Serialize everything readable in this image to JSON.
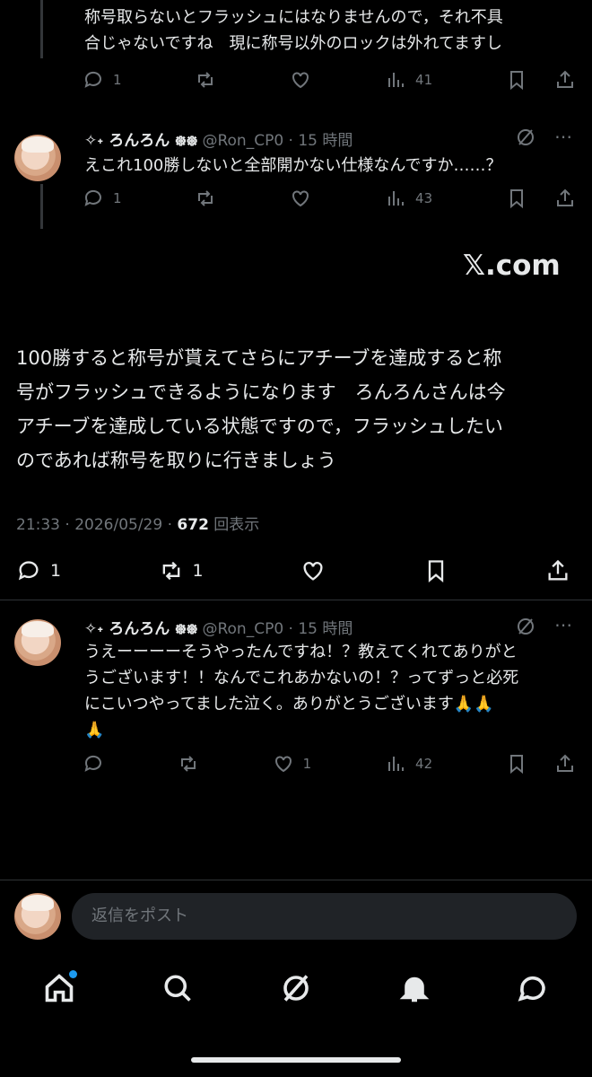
{
  "top_reply": {
    "text": "称号取らないとフラッシュにはなりませんので，それ不具合じゃないですね　現に称号以外のロックは外れてますし",
    "line1": "称号取らないとフラッシュにはなりませんので，それ不具",
    "line2": "合じゃないですね　現に称号以外のロックは外れてますし",
    "reply_count": "1",
    "view_count": "41"
  },
  "reply1": {
    "display_name": "✧˖ ろんろん ᪥᪥",
    "handle": "@Ron_CP0 · 15 時間",
    "text": "えこれ100勝しないと全部開かない仕様なんですか……？",
    "reply_count": "1",
    "view_count": "43"
  },
  "quoted_source": "𝕏.com",
  "main_post": {
    "line1": "100勝すると称号が貰えてさらにアチーブを達成すると称",
    "line2": "号がフラッシュできるようになります　ろんろんさんは今",
    "line3": "アチーブを達成している状態ですので，フラッシュしたい",
    "line4": "のであれば称号を取りに行きましょう",
    "time_date": "21:33 · 2026/05/29 · ",
    "views": "672",
    "views_label": " 回表示",
    "reply_count": "1",
    "repost_count": "1"
  },
  "reply2": {
    "display_name": "✧˖ ろんろん ᪥᪥",
    "handle": "@Ron_CP0 · 15 時間",
    "line1": "うえーーーーそうやったんですね！？教えてくれてありがと",
    "line2": "うございます！！なんでこれあかないの！？ってずっと必死",
    "line3": "にこいつやってました泣く。ありがとうございます🙏🙏",
    "line4": "🙏",
    "like_count": "1",
    "view_count": "42"
  },
  "reply_box": {
    "placeholder": "返信をポスト"
  },
  "colors": {
    "background": "#000000",
    "text": "#e7e9ea",
    "muted": "#71767b",
    "accent": "#1d9bf0"
  },
  "nav": [
    "home-icon",
    "search-icon",
    "grok-icon",
    "notifications-icon",
    "messages-icon"
  ]
}
